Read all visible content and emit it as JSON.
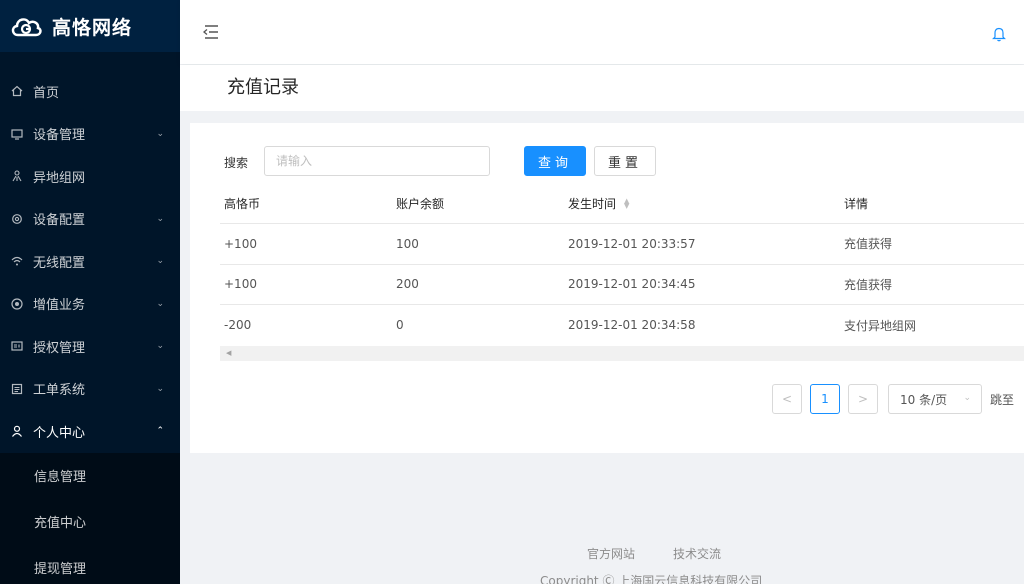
{
  "brand": {
    "name": "高恪网络"
  },
  "sidebar": {
    "items": [
      {
        "label": "首页",
        "icon": "home-icon",
        "expandable": false
      },
      {
        "label": "设备管理",
        "icon": "monitor-icon",
        "expandable": true
      },
      {
        "label": "异地组网",
        "icon": "network-icon",
        "expandable": false
      },
      {
        "label": "设备配置",
        "icon": "settings-icon",
        "expandable": true
      },
      {
        "label": "无线配置",
        "icon": "wifi-icon",
        "expandable": true
      },
      {
        "label": "增值业务",
        "icon": "value-added-icon",
        "expandable": true
      },
      {
        "label": "授权管理",
        "icon": "license-icon",
        "expandable": true
      },
      {
        "label": "工单系统",
        "icon": "ticket-icon",
        "expandable": true
      },
      {
        "label": "个人中心",
        "icon": "user-icon",
        "expandable": true,
        "open": true
      }
    ],
    "submenu": [
      {
        "label": "信息管理"
      },
      {
        "label": "充值中心"
      },
      {
        "label": "提现管理"
      }
    ]
  },
  "page": {
    "title": "充值记录"
  },
  "search": {
    "label": "搜索",
    "placeholder": "请输入",
    "query_label": "查询",
    "reset_label": "重置"
  },
  "table": {
    "columns": [
      "高恪币",
      "账户余额",
      "发生时间",
      "详情"
    ],
    "rows": [
      [
        "+100",
        "100",
        "2019-12-01 20:33:57",
        "充值获得"
      ],
      [
        "+100",
        "200",
        "2019-12-01 20:34:45",
        "充值获得"
      ],
      [
        "-200",
        "0",
        "2019-12-01 20:34:58",
        "支付异地组网"
      ]
    ]
  },
  "pagination": {
    "current": "1",
    "page_size": "10 条/页",
    "jump_label": "跳至"
  },
  "footer": {
    "links": [
      "官方网站",
      "技术交流"
    ],
    "copyright": "Copyright Ⓒ 上海国云信息科技有限公司"
  },
  "colors": {
    "sidebar_bg": "#001529",
    "accent": "#1890ff"
  }
}
